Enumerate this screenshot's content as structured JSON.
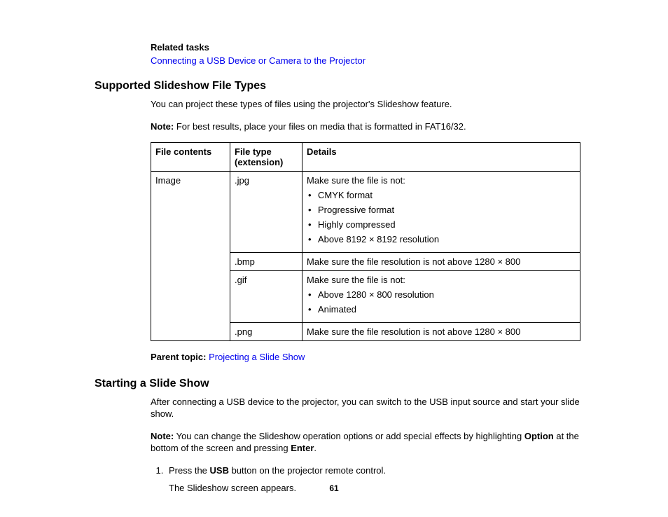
{
  "related": {
    "label": "Related tasks",
    "link": "Connecting a USB Device or Camera to the Projector"
  },
  "section1": {
    "heading": "Supported Slideshow File Types",
    "intro": "You can project these types of files using the projector's Slideshow feature.",
    "note_label": "Note:",
    "note_text": " For best results, place your files on media that is formatted in FAT16/32.",
    "table": {
      "headers": {
        "c1": "File contents",
        "c2": "File type (extension)",
        "c3": "Details"
      },
      "rows": {
        "image_label": "Image",
        "jpg": {
          "ext": ".jpg",
          "detail_intro": "Make sure the file is not:",
          "b1": "CMYK format",
          "b2": "Progressive format",
          "b3": "Highly compressed",
          "b4": "Above 8192 × 8192 resolution"
        },
        "bmp": {
          "ext": ".bmp",
          "detail": "Make sure the file resolution is not above 1280 × 800"
        },
        "gif": {
          "ext": ".gif",
          "detail_intro": "Make sure the file is not:",
          "b1": "Above 1280 × 800 resolution",
          "b2": "Animated"
        },
        "png": {
          "ext": ".png",
          "detail": "Make sure the file resolution is not above 1280 × 800"
        }
      }
    },
    "parent_label": "Parent topic: ",
    "parent_link": "Projecting a Slide Show"
  },
  "section2": {
    "heading": "Starting a Slide Show",
    "intro": "After connecting a USB device to the projector, you can switch to the USB input source and start your slide show.",
    "note_label": "Note:",
    "note_text1": " You can change the Slideshow operation options or add special effects by highlighting ",
    "note_bold1": "Option",
    "note_text2": " at the bottom of the screen and pressing ",
    "note_bold2": "Enter",
    "note_text3": ".",
    "step1a": "Press the ",
    "step1bold": "USB",
    "step1b": " button on the projector remote control.",
    "step1sub": "The Slideshow screen appears."
  },
  "page_number": "61"
}
